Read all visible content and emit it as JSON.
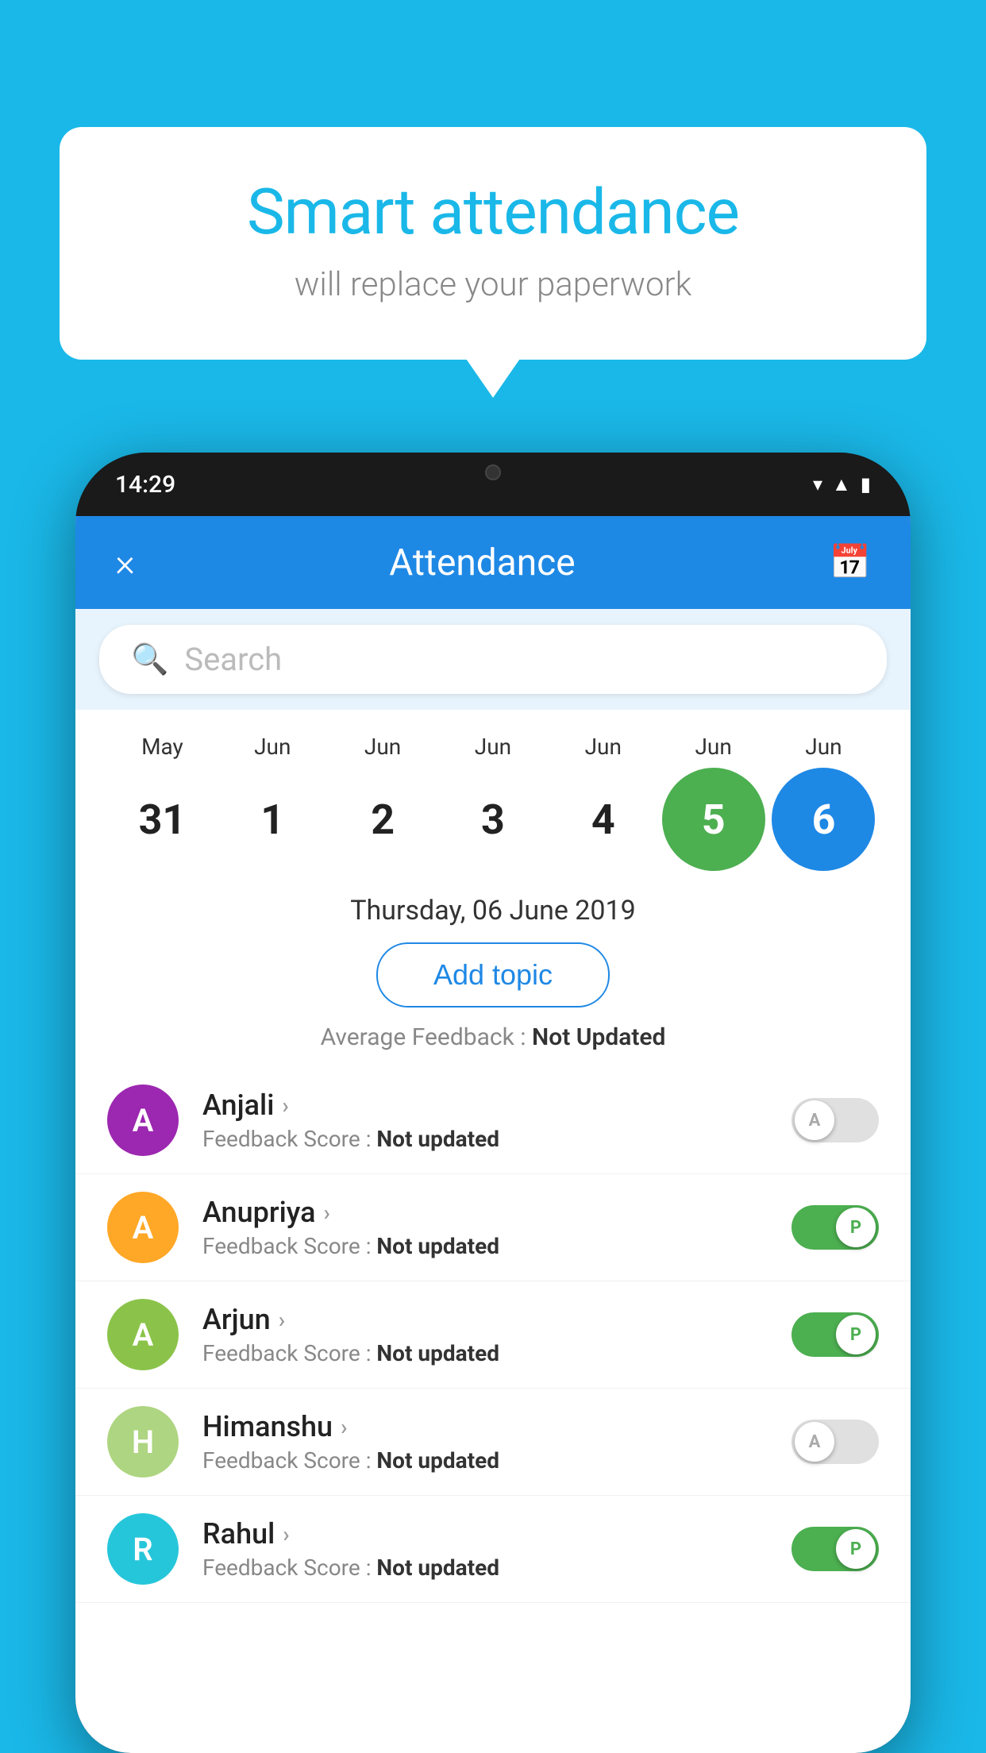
{
  "background": {
    "color": "#1ab8e8"
  },
  "speech_bubble": {
    "title": "Smart attendance",
    "subtitle": "will replace your paperwork"
  },
  "phone": {
    "time": "14:29",
    "status_icons": [
      "wifi",
      "signal",
      "battery"
    ]
  },
  "app": {
    "header": {
      "title": "Attendance",
      "close_label": "×",
      "calendar_icon": "📅"
    },
    "search": {
      "placeholder": "Search"
    },
    "calendar": {
      "months": [
        "May",
        "Jun",
        "Jun",
        "Jun",
        "Jun",
        "Jun",
        "Jun"
      ],
      "dates": [
        "31",
        "1",
        "2",
        "3",
        "4",
        "5",
        "6"
      ],
      "selected_green": 5,
      "selected_blue": 6
    },
    "selected_date": "Thursday, 06 June 2019",
    "add_topic_label": "Add topic",
    "average_feedback": {
      "label": "Average Feedback :",
      "value": "Not Updated"
    },
    "students": [
      {
        "name": "Anjali",
        "initial": "A",
        "avatar_color": "#9c27b0",
        "feedback_label": "Feedback Score :",
        "feedback_value": "Not updated",
        "attendance": "absent",
        "toggle_label": "A"
      },
      {
        "name": "Anupriya",
        "initial": "A",
        "avatar_color": "#ffa726",
        "feedback_label": "Feedback Score :",
        "feedback_value": "Not updated",
        "attendance": "present",
        "toggle_label": "P"
      },
      {
        "name": "Arjun",
        "initial": "A",
        "avatar_color": "#8bc34a",
        "feedback_label": "Feedback Score :",
        "feedback_value": "Not updated",
        "attendance": "present",
        "toggle_label": "P"
      },
      {
        "name": "Himanshu",
        "initial": "H",
        "avatar_color": "#aed581",
        "feedback_label": "Feedback Score :",
        "feedback_value": "Not updated",
        "attendance": "absent",
        "toggle_label": "A"
      },
      {
        "name": "Rahul",
        "initial": "R",
        "avatar_color": "#26c6da",
        "feedback_label": "Feedback Score :",
        "feedback_value": "Not updated",
        "attendance": "present",
        "toggle_label": "P"
      }
    ]
  }
}
